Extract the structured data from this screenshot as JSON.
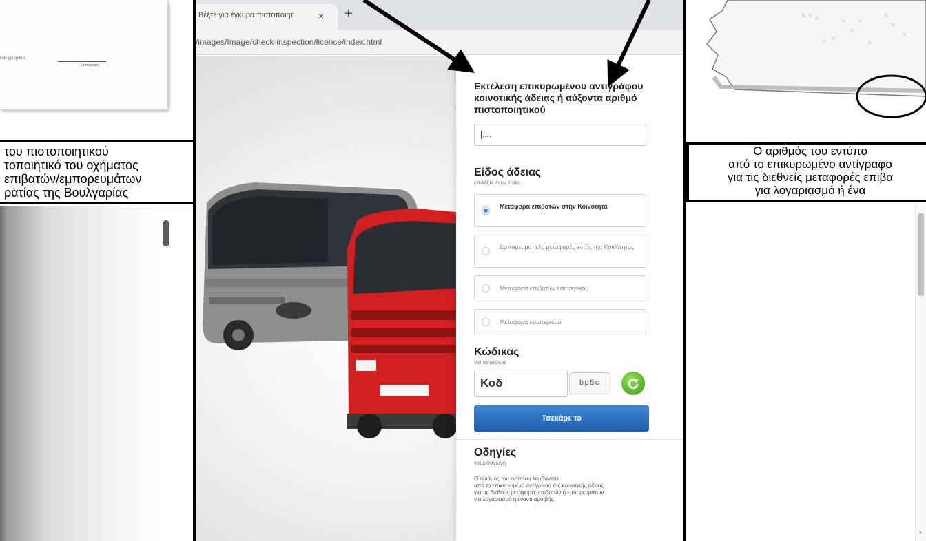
{
  "left_document": {
    "field_label": "ενει γραφείου",
    "field_sublabel": "(υπογραφή)"
  },
  "caption_left": {
    "lines": [
      "του πιστοποιητικού",
      "τοποιητικό του οχήματος",
      "επιβατών/εμπορευμάτων",
      "ρατίας της Βουλγαρίας"
    ]
  },
  "browser": {
    "tab_title": "Βέξτε για έγκυρα πιστοποιητ",
    "close_glyph": "×",
    "new_tab_glyph": "+",
    "url": "/images/Image/check-inspection/licence/index.html"
  },
  "form": {
    "heading": "Εκτέλεση επικυρωμένου αντιγράφου κοινοτικής άδειας ή αύξοντα αριθμό πιστοποιητικού",
    "certificate_value": "|....",
    "license_type": {
      "title": "Είδος άδειας",
      "hint": "επιλέξτε έναν τύπο",
      "options": [
        "Μεταφορά επιβατών στην Κοινότητα",
        "Εμπορευματικές μεταφορές εντός της Κοινότητας",
        "Μεταφορά επιβατών εσωτερικού",
        "Μεταφορά εσωτερικού"
      ],
      "selected_index": 0
    },
    "code": {
      "title": "Κώδικας",
      "hint": "για ασφάλεια",
      "input_value": "Κοδ",
      "captcha_text": "bp5c"
    },
    "submit_label": "Τσεκάρε το",
    "instructions": {
      "title": "Οδηγίες",
      "hint": "για εισαγωγή",
      "body_lines": [
        "Ο αριθμός του εντύπου λαμβάνεται",
        "από το επικυρωμένο αντίγραφο της κοινοτικής άδειας",
        "για τις διεθνείς μεταφορές επιβατών ή εμπορευμάτων",
        "για λογαριασμό ή έναντι αμοιβής."
      ]
    }
  },
  "caption_right": {
    "lines": [
      "Ο αριθμός του εντύπο",
      "από το επικυρωμένο αντίγραφο",
      "για τις διεθνείς μεταφορές επιβα",
      "για λογαριασμό ή ένα"
    ]
  },
  "colors": {
    "primary_button": "#2a6fc0",
    "radio_selected": "#3a86d6",
    "refresh_icon": "#5bb52b",
    "bus": "#8f8f8f",
    "truck": "#d31f1f",
    "caption_border": "#000000"
  },
  "icons": {
    "refresh": "refresh-icon",
    "close": "close-icon",
    "new_tab": "plus-icon"
  }
}
